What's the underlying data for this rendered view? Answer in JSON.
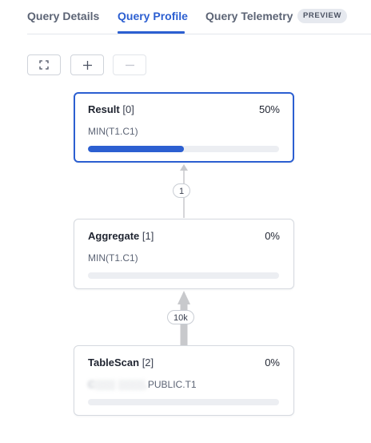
{
  "tabs": [
    {
      "label": "Query Details",
      "active": false
    },
    {
      "label": "Query Profile",
      "active": true
    },
    {
      "label": "Query Telemetry",
      "active": false,
      "badge": "PREVIEW"
    }
  ],
  "toolbar": {
    "buttons": [
      {
        "icon": "fullscreen-icon",
        "enabled": true
      },
      {
        "icon": "plus-icon",
        "enabled": true
      },
      {
        "icon": "minus-icon",
        "enabled": false
      }
    ]
  },
  "colors": {
    "accent": "#2c5fd1",
    "text": "#1f2430",
    "muted": "#5c6475",
    "border": "#d5d9df",
    "edge": "#c8c9cc"
  },
  "nodes": [
    {
      "name": "Result",
      "index": "[0]",
      "percent": "50%",
      "progress": 0.5,
      "detail": "MIN(T1.C1)",
      "selected": true
    },
    {
      "name": "Aggregate",
      "index": "[1]",
      "percent": "0%",
      "progress": 0,
      "detail": "MIN(T1.C1)",
      "selected": false
    },
    {
      "name": "TableScan",
      "index": "[2]",
      "percent": "0%",
      "progress": 0,
      "detail_redacted": "C░░░ ░░░░.",
      "detail": "PUBLIC.T1",
      "selected": false
    }
  ],
  "edges": [
    {
      "from": "Aggregate",
      "to": "Result",
      "rows": "1"
    },
    {
      "from": "TableScan",
      "to": "Aggregate",
      "rows": "10k"
    }
  ]
}
